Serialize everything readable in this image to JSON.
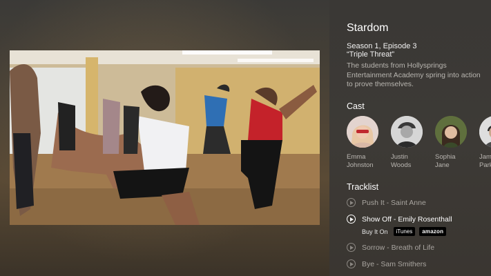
{
  "show": {
    "title": "Stardom",
    "episode": "Season 1, Episode 3",
    "episode_title": "“Triple Threat”",
    "description": "The students from Hollysprings Entertainment Academy spring into action to prove themselves."
  },
  "cast": {
    "heading": "Cast",
    "members": [
      {
        "first": "Emma",
        "last": "Johnston"
      },
      {
        "first": "Justin",
        "last": "Woods"
      },
      {
        "first": "Sophia",
        "last": "Jane"
      },
      {
        "first": "James",
        "last": "Parker"
      }
    ]
  },
  "tracklist": {
    "heading": "Tracklist",
    "tracks": [
      {
        "label": "Push It - Saint Anne",
        "active": false
      },
      {
        "label": "Show Off - Emily Rosenthall",
        "active": true
      },
      {
        "label": "Sorrow - Breath of Life",
        "active": false
      },
      {
        "label": "Bye - Sam Smithers",
        "active": false
      }
    ],
    "buy": {
      "label": "Buy It On",
      "stores": [
        "iTunes",
        "amazon"
      ]
    }
  },
  "icons": {
    "play": "play-circle-icon"
  }
}
